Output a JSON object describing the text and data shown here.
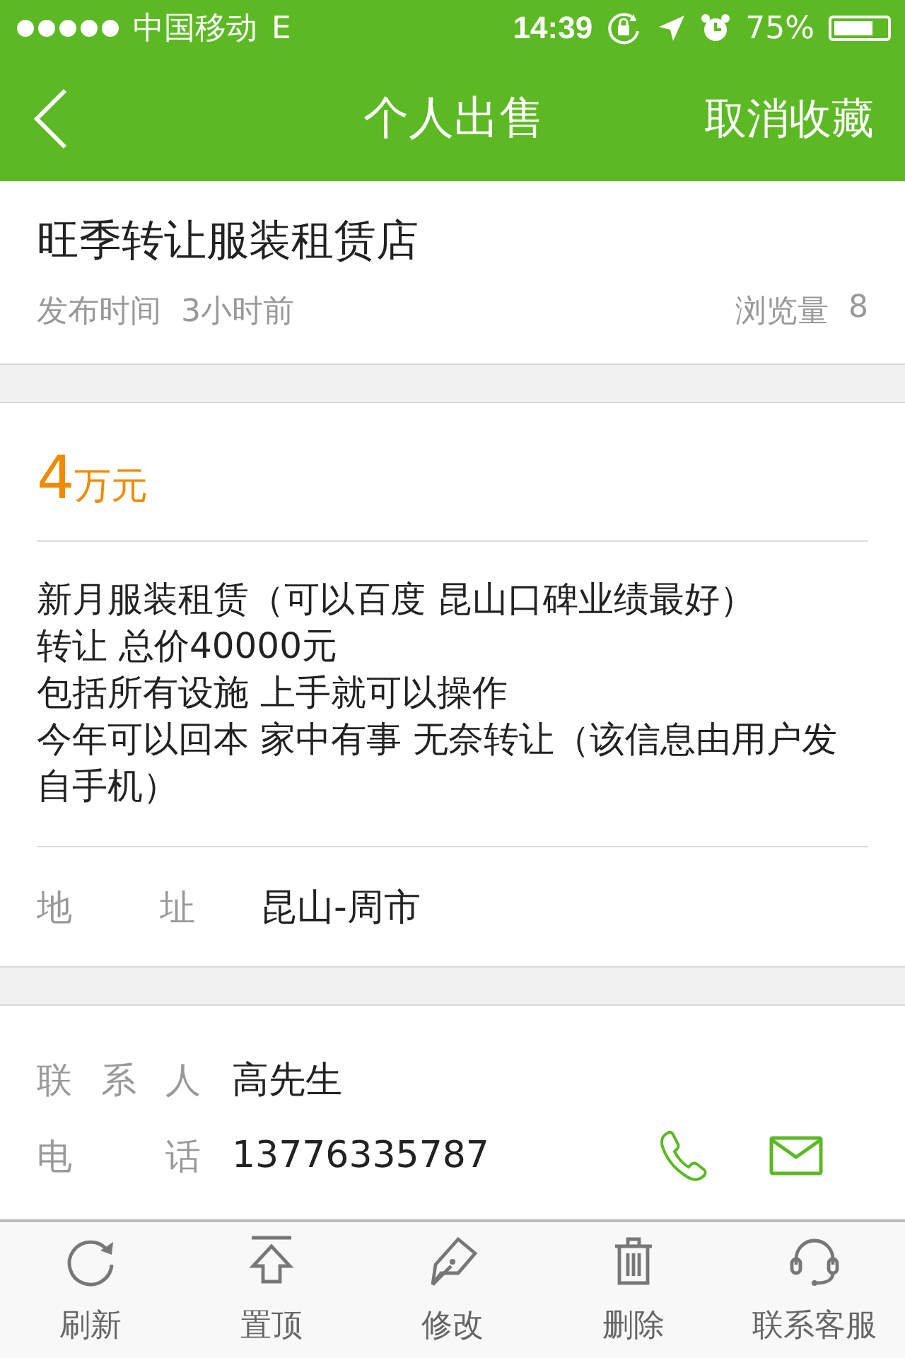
{
  "status_bar": {
    "carrier": "中国移动",
    "network": "E",
    "time": "14:39",
    "battery_text": "75%"
  },
  "nav": {
    "title": "个人出售",
    "action": "取消收藏"
  },
  "listing": {
    "title": "旺季转让服装租赁店",
    "posted_label": "发布时间",
    "posted_value": "3小时前",
    "views_label": "浏览量",
    "views_value": "8"
  },
  "price": {
    "amount": "4",
    "unit": "万元"
  },
  "description": [
    "新月服装租赁（可以百度 昆山口碑业绩最好）",
    "转让 总价40000元",
    "包括所有设施 上手就可以操作",
    "今年可以回本 家中有事 无奈转让（该信息由用户发自手机）"
  ],
  "address": {
    "label": "地址",
    "value": "昆山-周市"
  },
  "contact": {
    "name_label": "联系人",
    "name": "高先生",
    "phone_label": "电话",
    "phone": "13776335787"
  },
  "toolbar": [
    {
      "kind": "refresh",
      "label": "刷新"
    },
    {
      "kind": "top",
      "label": "置顶"
    },
    {
      "kind": "edit",
      "label": "修改"
    },
    {
      "kind": "delete",
      "label": "删除"
    },
    {
      "kind": "service",
      "label": "联系客服"
    }
  ]
}
